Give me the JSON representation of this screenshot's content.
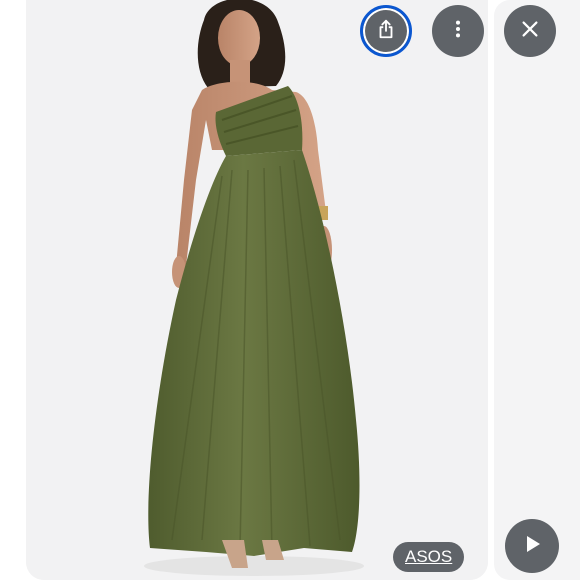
{
  "viewer": {
    "source_label": "ASOS",
    "image_subject": "olive-one-shoulder-tulle-maxi-dress",
    "colors": {
      "button_bg": "#5f6368",
      "focus_ring": "#0b57d0",
      "dress": "#5e6b39",
      "photo_bg": "#f2f2f3"
    }
  },
  "controls": {
    "share_icon": "share-icon",
    "more_icon": "more-vert-icon",
    "close_icon": "close-icon",
    "play_icon": "play-icon"
  }
}
